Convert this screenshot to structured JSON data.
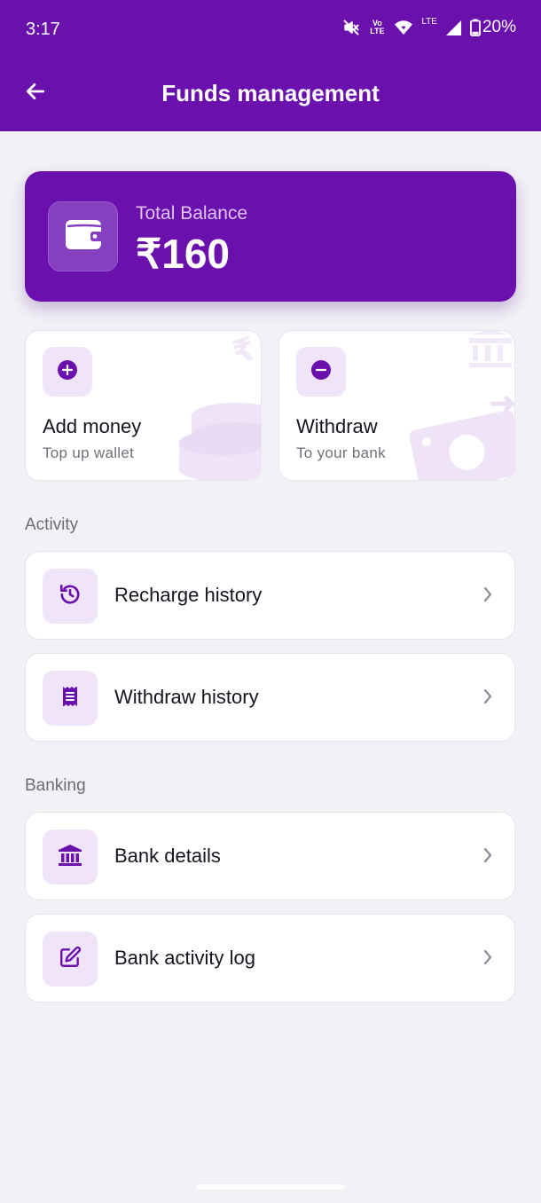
{
  "status_bar": {
    "time": "3:17",
    "volte_label": "Vo LTE",
    "network_label": "LTE",
    "battery": "20%",
    "icons": [
      "mute-icon",
      "volte-icon",
      "wifi-icon",
      "signal-icon",
      "battery-icon"
    ]
  },
  "header": {
    "title": "Funds management",
    "back_icon": "arrow-left-icon"
  },
  "balance": {
    "label": "Total Balance",
    "amount": "₹160",
    "icon": "wallet-icon"
  },
  "actions": [
    {
      "title": "Add money",
      "subtitle": "Top up wallet",
      "icon": "plus-circle-icon"
    },
    {
      "title": "Withdraw",
      "subtitle": "To your bank",
      "icon": "minus-circle-icon"
    }
  ],
  "sections": [
    {
      "label": "Activity",
      "items": [
        {
          "label": "Recharge history",
          "icon": "history-icon"
        },
        {
          "label": "Withdraw history",
          "icon": "receipt-icon"
        }
      ]
    },
    {
      "label": "Banking",
      "items": [
        {
          "label": "Bank details",
          "icon": "bank-icon"
        },
        {
          "label": "Bank activity log",
          "icon": "edit-icon"
        }
      ]
    }
  ],
  "colors": {
    "primary": "#6a10ad",
    "icon_bg": "#efe4f8",
    "background": "#f2f2f6",
    "card": "#ffffff"
  }
}
